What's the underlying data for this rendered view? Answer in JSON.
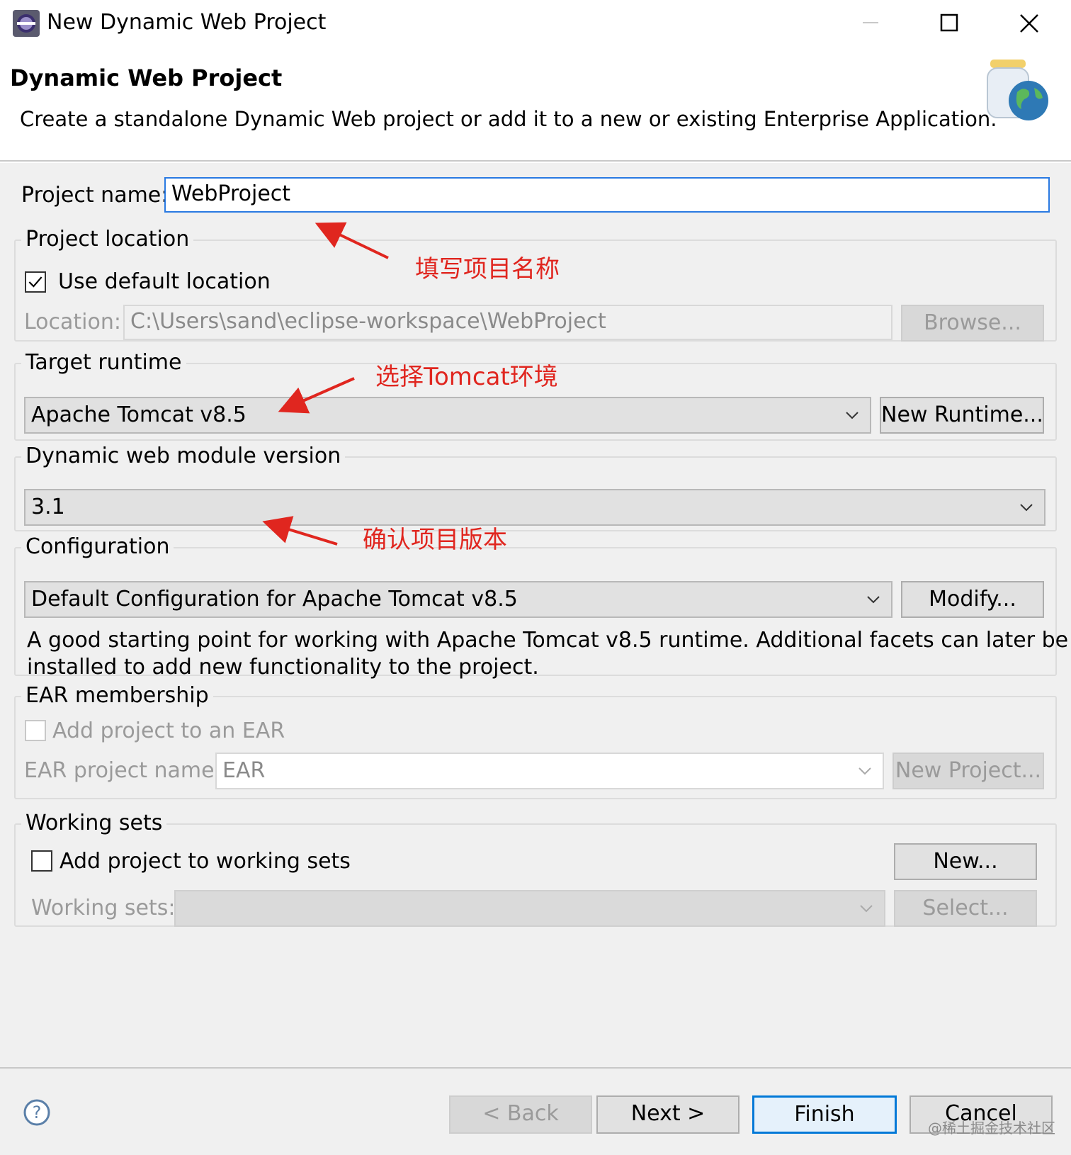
{
  "window": {
    "title": "New Dynamic Web Project"
  },
  "header": {
    "title": "Dynamic Web Project",
    "description": "Create a standalone Dynamic Web project or add it to a new or existing Enterprise Application."
  },
  "project_name": {
    "label": "Project name:",
    "value": "WebProject"
  },
  "project_location": {
    "group_label": "Project location",
    "use_default_label": "Use default location",
    "use_default_checked": true,
    "location_label": "Location:",
    "location_value": "C:\\Users\\sand\\eclipse-workspace\\WebProject",
    "browse_label": "Browse..."
  },
  "target_runtime": {
    "group_label": "Target runtime",
    "selected": "Apache Tomcat v8.5",
    "new_runtime_label": "New Runtime..."
  },
  "module_version": {
    "group_label": "Dynamic web module version",
    "selected": "3.1"
  },
  "configuration": {
    "group_label": "Configuration",
    "selected": "Default Configuration for Apache Tomcat v8.5",
    "modify_label": "Modify...",
    "description_line1": "A good starting point for working with Apache Tomcat v8.5 runtime. Additional facets can later be",
    "description_line2": "installed to add new functionality to the project."
  },
  "ear_membership": {
    "group_label": "EAR membership",
    "add_to_ear_label": "Add project to an EAR",
    "add_to_ear_checked": false,
    "ear_name_label": "EAR project name:",
    "ear_name_value": "EAR",
    "new_project_label": "New Project..."
  },
  "working_sets": {
    "group_label": "Working sets",
    "add_label": "Add project to working sets",
    "add_checked": false,
    "new_label": "New...",
    "sets_label": "Working sets:",
    "sets_value": "",
    "select_label": "Select..."
  },
  "annotations": {
    "name_note": "填写项目名称",
    "runtime_note": "选择Tomcat环境",
    "version_note": "确认项目版本",
    "color": "#e0261f"
  },
  "footer": {
    "back_label": "< Back",
    "next_label": "Next >",
    "finish_label": "Finish",
    "cancel_label": "Cancel",
    "watermark": "@稀土掘金技术社区"
  },
  "colors": {
    "focus_border": "#2a7ae2",
    "default_button_border": "#0078d7",
    "dialog_background": "#f0f0f0"
  }
}
